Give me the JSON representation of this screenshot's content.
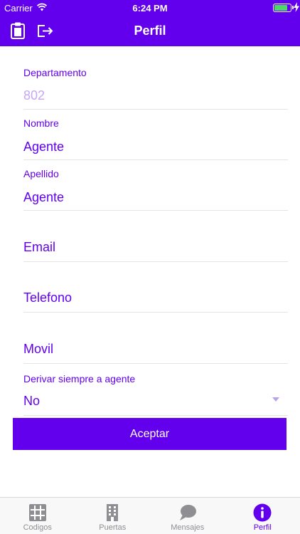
{
  "status_bar": {
    "carrier": "Carrier",
    "time": "6:24 PM",
    "battery_level": 0.85
  },
  "nav_bar": {
    "title": "Perfil",
    "left_icons": [
      "clipboard-icon",
      "logout-icon"
    ]
  },
  "form": {
    "fields": [
      {
        "label": "Departamento",
        "value": "802",
        "placeholder_style": true
      },
      {
        "label": "Nombre",
        "value": "Agente"
      },
      {
        "label": "Apellido",
        "value": "Agente"
      },
      {
        "label": "",
        "value": "Email"
      },
      {
        "label": "",
        "value": "Telefono"
      },
      {
        "label": "",
        "value": "Movil"
      },
      {
        "label": "Derivar siempre a agente",
        "value": "No"
      }
    ],
    "accept_label": "Aceptar"
  },
  "tab_bar": {
    "tabs": [
      {
        "label": "Codigos",
        "icon": "grid-icon"
      },
      {
        "label": "Puertas",
        "icon": "building-icon"
      },
      {
        "label": "Mensajes",
        "icon": "chat-bubble-icon"
      },
      {
        "label": "Perfil",
        "icon": "info-icon"
      }
    ],
    "active_tab": "Perfil"
  },
  "colors": {
    "brand": "#6200ee",
    "placeholder": "#c7a6f4",
    "inactive_tab": "#8e8e93",
    "battery": "#4cd964"
  }
}
